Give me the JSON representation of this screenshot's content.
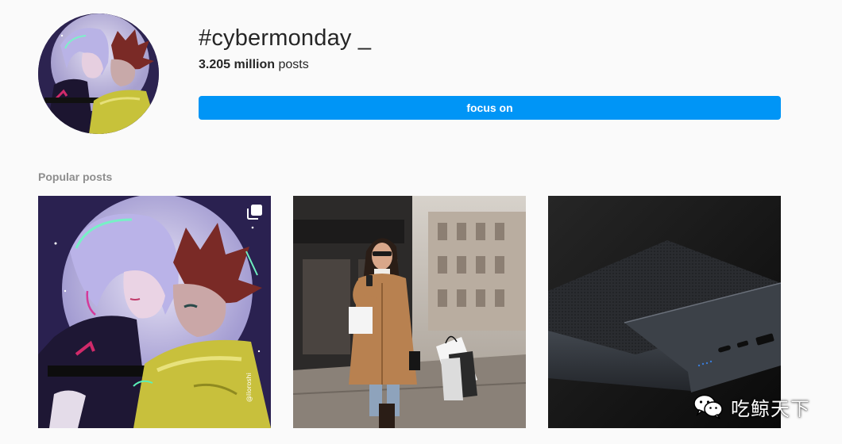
{
  "hashtag": {
    "title": "#cybermonday _",
    "post_count_value": "3.205 million",
    "post_count_suffix": " posts",
    "follow_label": "focus on"
  },
  "section": {
    "heading": "Popular posts"
  },
  "posts": [
    {
      "kind": "illustration",
      "multi_image": true,
      "watermark_text": "@lioroshi"
    },
    {
      "kind": "photo",
      "multi_image": false
    },
    {
      "kind": "photo",
      "multi_image": false
    }
  ],
  "watermark": {
    "text": "吃鲸天下",
    "icon": "wechat-icon"
  },
  "colors": {
    "accent": "#0095f6",
    "background": "#fafafa",
    "muted_text": "#8e8e8e"
  }
}
